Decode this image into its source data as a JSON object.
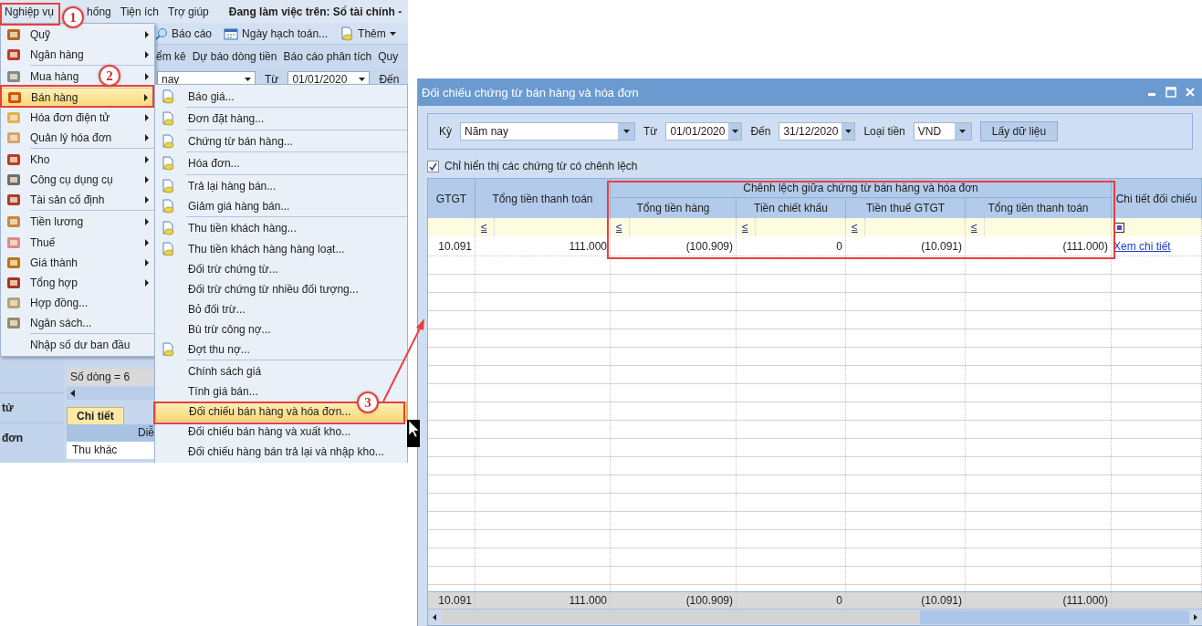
{
  "app": {
    "menu_bar": [
      "Nghiệp vụ",
      "hống",
      "Tiện ích",
      "Trợ giúp"
    ],
    "workspace": "Đang làm việc trên: Sổ tài chính -",
    "toolbar": [
      {
        "label": "Báo cáo",
        "kind": "report"
      },
      {
        "label": "Ngày hạch toán...",
        "kind": "calendar"
      },
      {
        "label": "Thêm",
        "kind": "add"
      }
    ],
    "tabs": [
      "ểm kê",
      "Dự báo dòng tiền",
      "Báo cáo phân tích",
      "Quy"
    ],
    "period": "nay",
    "from_label": "Từ",
    "from": "01/01/2020",
    "to_label": "Đến",
    "row_count": "Số dòng = 6",
    "nav_items": [
      "tử",
      "đơn"
    ],
    "detail_tab": "Chi tiết",
    "detail_header": "Diễ",
    "detail_row": "Thu khác"
  },
  "main_menu": [
    {
      "label": "Quỹ",
      "icon": true,
      "submenu": true,
      "selected": false,
      "separator_before": false
    },
    {
      "label": "Ngân hàng",
      "icon": true,
      "submenu": true,
      "selected": false,
      "separator_before": false
    },
    {
      "label": "Mua hàng",
      "icon": true,
      "submenu": true,
      "selected": false,
      "separator_before": true
    },
    {
      "label": "Bán hàng",
      "icon": true,
      "submenu": true,
      "selected": true,
      "separator_before": false
    },
    {
      "label": "Hóa đơn điện tử",
      "icon": true,
      "submenu": true,
      "selected": false,
      "separator_before": false
    },
    {
      "label": "Quản lý hóa đơn",
      "icon": true,
      "submenu": true,
      "selected": false,
      "separator_before": false
    },
    {
      "label": "Kho",
      "icon": true,
      "submenu": true,
      "selected": false,
      "separator_before": true
    },
    {
      "label": "Công cụ dụng cụ",
      "icon": true,
      "submenu": true,
      "selected": false,
      "separator_before": false
    },
    {
      "label": "Tài sản cố định",
      "icon": true,
      "submenu": true,
      "selected": false,
      "separator_before": false
    },
    {
      "label": "Tiền lương",
      "icon": true,
      "submenu": true,
      "selected": false,
      "separator_before": true
    },
    {
      "label": "Thuế",
      "icon": true,
      "submenu": true,
      "selected": false,
      "separator_before": false
    },
    {
      "label": "Giá thành",
      "icon": true,
      "submenu": true,
      "selected": false,
      "separator_before": false
    },
    {
      "label": "Tổng hợp",
      "icon": true,
      "submenu": true,
      "selected": false,
      "separator_before": false
    },
    {
      "label": "Hợp đồng...",
      "icon": true,
      "submenu": false,
      "selected": false,
      "separator_before": false
    },
    {
      "label": "Ngân sách...",
      "icon": true,
      "submenu": false,
      "selected": false,
      "separator_before": false
    },
    {
      "label": "Nhập số dư ban đầu",
      "icon": false,
      "submenu": false,
      "selected": false,
      "separator_before": true
    }
  ],
  "sub_menu": [
    {
      "label": "Báo giá...",
      "icon": true,
      "selected": false,
      "separator_before": false
    },
    {
      "label": "Đơn đặt hàng...",
      "icon": true,
      "selected": false,
      "separator_before": true
    },
    {
      "label": "Chứng từ bán hàng...",
      "icon": true,
      "selected": false,
      "separator_before": true
    },
    {
      "label": "Hóa đơn...",
      "icon": true,
      "selected": false,
      "separator_before": true
    },
    {
      "label": "Trả lại hàng bán...",
      "icon": true,
      "selected": false,
      "separator_before": true
    },
    {
      "label": "Giảm giá hàng bán...",
      "icon": true,
      "selected": false,
      "separator_before": false
    },
    {
      "label": "Thu tiền khách hàng...",
      "icon": true,
      "selected": false,
      "separator_before": true
    },
    {
      "label": "Thu tiền khách hàng hàng loạt...",
      "icon": true,
      "selected": false,
      "separator_before": false
    },
    {
      "label": "Đối trừ chứng từ...",
      "icon": false,
      "selected": false,
      "separator_before": false
    },
    {
      "label": "Đối trừ chứng từ nhiều đối tượng...",
      "icon": false,
      "selected": false,
      "separator_before": false
    },
    {
      "label": "Bỏ đối trừ...",
      "icon": false,
      "selected": false,
      "separator_before": false
    },
    {
      "label": "Bù trừ công nợ...",
      "icon": false,
      "selected": false,
      "separator_before": false
    },
    {
      "label": "Đợt thu nợ...",
      "icon": true,
      "selected": false,
      "separator_before": false
    },
    {
      "label": "Chính sách giá",
      "icon": false,
      "selected": false,
      "separator_before": true
    },
    {
      "label": "Tính giá bán...",
      "icon": false,
      "selected": false,
      "separator_before": false
    },
    {
      "label": "Đối chiếu bán hàng và hóa đơn...",
      "icon": false,
      "selected": true,
      "separator_before": false
    },
    {
      "label": "Đối chiếu bán hàng và xuất kho...",
      "icon": false,
      "selected": false,
      "separator_before": false
    },
    {
      "label": "Đối chiếu hàng bán trả lại và nhập kho...",
      "icon": false,
      "selected": false,
      "separator_before": false
    }
  ],
  "dialog": {
    "title": "Đối chiếu chứng từ bán hàng và hóa đơn",
    "filters": {
      "period_label": "Kỳ",
      "period": "Năm nay",
      "from_label": "Từ",
      "from": "01/01/2020",
      "to_label": "Đến",
      "to": "31/12/2020",
      "currency_label": "Loại tiền",
      "currency": "VND",
      "button": "Lấy dữ liệu"
    },
    "only_differences": {
      "label": "Chỉ hiển thị các chứng từ có chênh lệch",
      "checked": true
    },
    "grid": {
      "band": "Chênh lệch giữa chứng từ bán hàng và hóa đơn",
      "columns": [
        {
          "header": "GTGT",
          "kind": "number",
          "in_band": false
        },
        {
          "header": "Tổng tiền thanh toán",
          "kind": "number",
          "in_band": false,
          "filter": "≤"
        },
        {
          "header": "Tổng tiền hàng",
          "kind": "number",
          "in_band": true,
          "filter": "≤"
        },
        {
          "header": "Tiền chiết khấu",
          "kind": "number",
          "in_band": true,
          "filter": "≤"
        },
        {
          "header": "Tiền thuế GTGT",
          "kind": "number",
          "in_band": true,
          "filter": "≤"
        },
        {
          "header": "Tổng tiền thanh toán",
          "kind": "number",
          "in_band": true,
          "filter": "≤"
        },
        {
          "header": "Chi tiết đối chiếu",
          "kind": "link",
          "in_band": false
        }
      ],
      "rows": [
        [
          "10.091",
          "111.000",
          "(100.909)",
          "0",
          "(10.091)",
          "(111.000)",
          "Xem chi tiết"
        ]
      ],
      "totals": [
        "10.091",
        "111.000",
        "(100.909)",
        "0",
        "(10.091)",
        "(111.000)"
      ]
    }
  },
  "annotations": [
    "1",
    "2",
    "3"
  ]
}
